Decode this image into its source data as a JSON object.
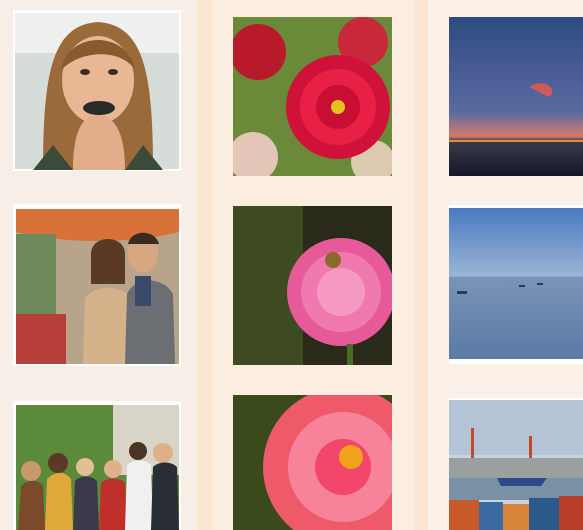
{
  "gallery": {
    "columns": [
      {
        "id": "portraits",
        "photos": [
          {
            "subject": "woman-portrait"
          },
          {
            "subject": "couple-outdoor"
          },
          {
            "subject": "group-friends"
          }
        ]
      },
      {
        "id": "flowers",
        "photos": [
          {
            "subject": "red-dahlia"
          },
          {
            "subject": "pink-dahlia"
          },
          {
            "subject": "coral-dahlia"
          }
        ]
      },
      {
        "id": "seascapes",
        "photos": [
          {
            "subject": "sunset-sea"
          },
          {
            "subject": "calm-bay"
          },
          {
            "subject": "container-port"
          }
        ]
      }
    ]
  },
  "colors": {
    "page_background": "#f7ede6",
    "column_divider": "#fae6d3",
    "photo_frame": "#ffffff"
  }
}
